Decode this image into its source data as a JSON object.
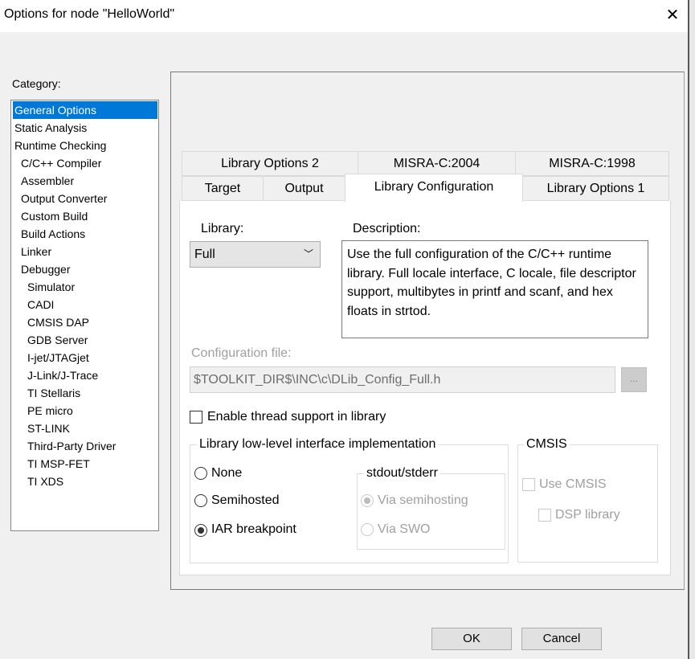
{
  "window": {
    "title": "Options for node \"HelloWorld\"",
    "close_icon": "close-icon"
  },
  "category": {
    "label": "Category:",
    "items": [
      {
        "label": "General Options",
        "selected": true
      },
      {
        "label": "Static Analysis"
      },
      {
        "label": "Runtime Checking"
      },
      {
        "label": "C/C++ Compiler"
      },
      {
        "label": "Assembler"
      },
      {
        "label": "Output Converter"
      },
      {
        "label": "Custom Build"
      },
      {
        "label": "Build Actions"
      },
      {
        "label": "Linker"
      },
      {
        "label": "Debugger"
      },
      {
        "label": "Simulator"
      },
      {
        "label": "CADI"
      },
      {
        "label": "CMSIS DAP"
      },
      {
        "label": "GDB Server"
      },
      {
        "label": "I-jet/JTAGjet"
      },
      {
        "label": "J-Link/J-Trace"
      },
      {
        "label": "TI Stellaris"
      },
      {
        "label": "PE micro"
      },
      {
        "label": "ST-LINK"
      },
      {
        "label": "Third-Party Driver"
      },
      {
        "label": "TI MSP-FET"
      },
      {
        "label": "TI XDS"
      }
    ]
  },
  "tabs": {
    "row1": [
      "Library Options 2",
      "MISRA-C:2004",
      "MISRA-C:1998"
    ],
    "row2": [
      "Target",
      "Output",
      "Library Configuration",
      "Library Options 1"
    ],
    "selected": "Library Configuration"
  },
  "library": {
    "label": "Library:",
    "value": "Full",
    "description_label": "Description:",
    "description": "Use the full configuration of the C/C++ runtime library. Full locale interface, C locale, file descriptor support, multibytes in printf and scanf, and hex floats in strtod."
  },
  "config_file": {
    "label": "Configuration file:",
    "value": "$TOOLKIT_DIR$\\INC\\c\\DLib_Config_Full.h",
    "browse": "..."
  },
  "thread_support": {
    "label": "Enable thread support in library",
    "checked": false
  },
  "low_level": {
    "title": "Library low-level interface implementation",
    "options": [
      "None",
      "Semihosted",
      "IAR breakpoint"
    ],
    "selected": "IAR breakpoint",
    "stdout": {
      "title": "stdout/stderr",
      "options": [
        "Via semihosting",
        "Via SWO"
      ],
      "selected": "Via semihosting"
    }
  },
  "cmsis": {
    "title": "CMSIS",
    "use_cmsis": "Use CMSIS",
    "dsp_library": "DSP library"
  },
  "buttons": {
    "ok": "OK",
    "cancel": "Cancel"
  }
}
